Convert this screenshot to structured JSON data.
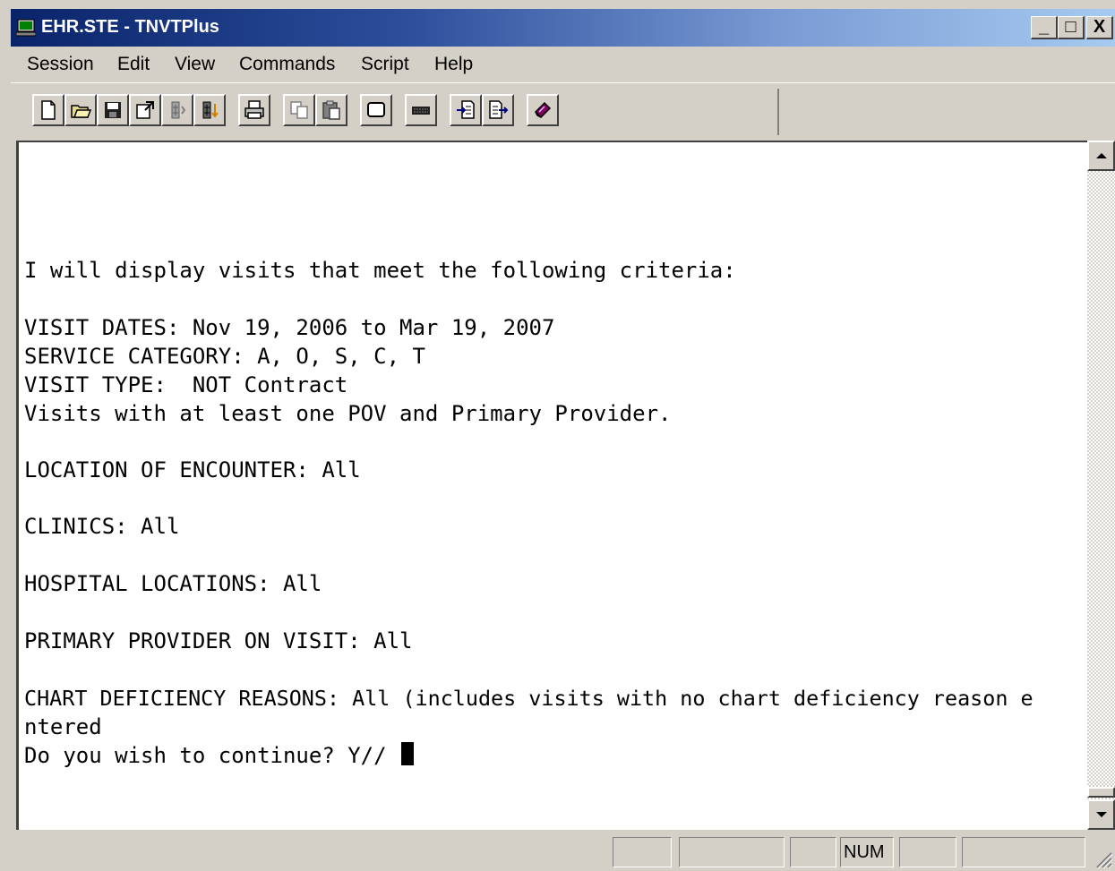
{
  "window": {
    "title": "EHR.STE - TNVTPlus",
    "controls": {
      "minimize": "_",
      "maximize": "□",
      "close": "X"
    }
  },
  "menu": {
    "items": [
      "Session",
      "Edit",
      "View",
      "Commands",
      "Script",
      "Help"
    ]
  },
  "toolbar": {
    "buttons": [
      "new-icon",
      "open-icon",
      "save-icon",
      "properties-icon",
      "connect-icon",
      "disconnect-icon",
      "print-icon",
      "copy-icon",
      "paste-icon",
      "screen-icon",
      "keyboard-icon",
      "receive-file-icon",
      "send-file-icon",
      "help-book-icon"
    ]
  },
  "terminal": {
    "lines": [
      "I will display visits that meet the following criteria:",
      "VISIT DATES: Nov 19, 2006 to Mar 19, 2007",
      "SERVICE CATEGORY: A, O, S, C, T",
      "VISIT TYPE:  NOT Contract",
      "Visits with at least one POV and Primary Provider.",
      "LOCATION OF ENCOUNTER: All",
      "CLINICS: All",
      "HOSPITAL LOCATIONS: All",
      "PRIMARY PROVIDER ON VISIT: All",
      "CHART DEFICIENCY REASONS: All (includes visits with no chart deficiency reason e",
      "ntered",
      "Do you wish to continue? Y// "
    ]
  },
  "statusbar": {
    "num": "NUM"
  }
}
